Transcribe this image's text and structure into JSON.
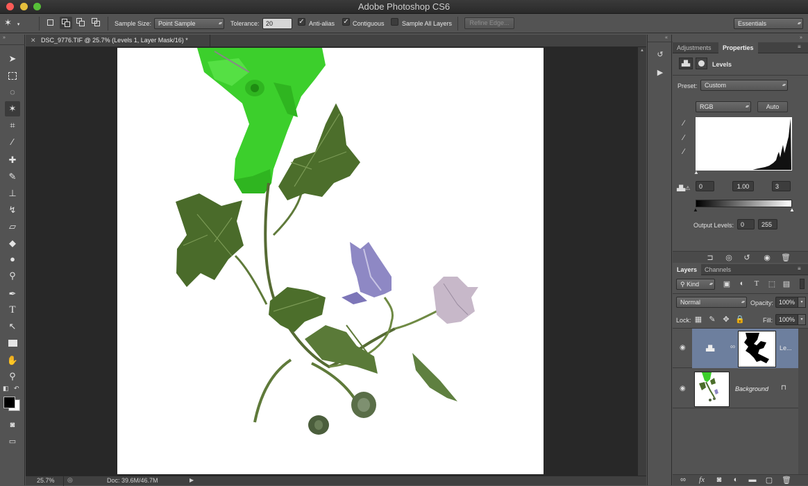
{
  "app": {
    "title": "Adobe Photoshop CS6"
  },
  "options": {
    "sample_size_label": "Sample Size:",
    "sample_size_value": "Point Sample",
    "tolerance_label": "Tolerance:",
    "tolerance_value": "20",
    "antialias_label": "Anti-alias",
    "contiguous_label": "Contiguous",
    "sample_all_layers_label": "Sample All Layers",
    "refine_edge_label": "Refine Edge...",
    "workspace_value": "Essentials"
  },
  "document": {
    "tab_title": "DSC_9776.TIF @ 25.7% (Levels 1, Layer Mask/16) *",
    "zoom": "25.7%",
    "doc_size": "Doc: 39.6M/46.7M"
  },
  "properties_panel": {
    "tabs": [
      "Adjustments",
      "Properties"
    ],
    "adjustment_name": "Levels",
    "preset_label": "Preset:",
    "preset_value": "Custom",
    "channel_value": "RGB",
    "auto_label": "Auto",
    "input_black": "0",
    "input_gamma": "1.00",
    "input_white": "3",
    "output_levels_label": "Output Levels:",
    "output_black": "0",
    "output_white": "255"
  },
  "layers_panel": {
    "tabs": [
      "Layers",
      "Channels"
    ],
    "kind_label": "Kind",
    "blend_mode": "Normal",
    "opacity_label": "Opacity:",
    "opacity_value": "100%",
    "lock_label": "Lock:",
    "fill_label": "Fill:",
    "fill_value": "100%",
    "layers": [
      {
        "name": "Le...",
        "selected": true
      },
      {
        "name": "Background",
        "selected": false
      }
    ]
  },
  "colors": {
    "selected_layer": "#6d7f9e",
    "traffic_red": "#fc5b57",
    "traffic_yellow": "#e5bf3c",
    "traffic_green": "#57c038"
  }
}
